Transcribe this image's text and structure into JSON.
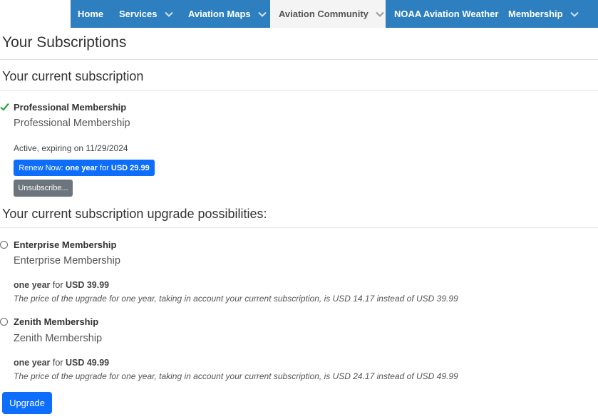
{
  "nav": {
    "items": [
      {
        "label": "Home",
        "dropdown": false,
        "active": false
      },
      {
        "label": "Services",
        "dropdown": true,
        "active": false
      },
      {
        "label": "Aviation Maps",
        "dropdown": true,
        "active": false
      },
      {
        "label": "Aviation Community",
        "dropdown": true,
        "active": true
      },
      {
        "label": "NOAA Aviation Weather",
        "dropdown": false,
        "active": false
      },
      {
        "label": "Membership",
        "dropdown": true,
        "active": false
      }
    ]
  },
  "page": {
    "title": "Your Subscriptions",
    "current_heading": "Your current subscription",
    "upgrade_heading": "Your current subscription upgrade possibilities:"
  },
  "current": {
    "name": "Professional Membership",
    "description": "Professional Membership",
    "status": "Active, expiring on 11/29/2024",
    "renew": {
      "prefix": "Renew Now: ",
      "period": "one year",
      "for": " for ",
      "price": "USD 29.99"
    },
    "unsubscribe_label": "Unsubscribe..."
  },
  "upgrades": [
    {
      "name": "Enterprise Membership",
      "description": "Enterprise Membership",
      "period": "one year",
      "for": " for ",
      "price": "USD 39.99",
      "note": "The price of the upgrade for one year, taking in account your current subscription, is USD 14.17 instead of USD 39.99"
    },
    {
      "name": "Zenith Membership",
      "description": "Zenith Membership",
      "period": "one year",
      "for": " for ",
      "price": "USD 49.99",
      "note": "The price of the upgrade for one year, taking in account your current subscription, is USD 24.17 instead of USD 49.99"
    }
  ],
  "upgrade_button_label": "Upgrade",
  "colors": {
    "nav_bg": "#2e7fbf",
    "primary": "#0d6efd",
    "secondary": "#6c757d",
    "check": "#28a745"
  }
}
